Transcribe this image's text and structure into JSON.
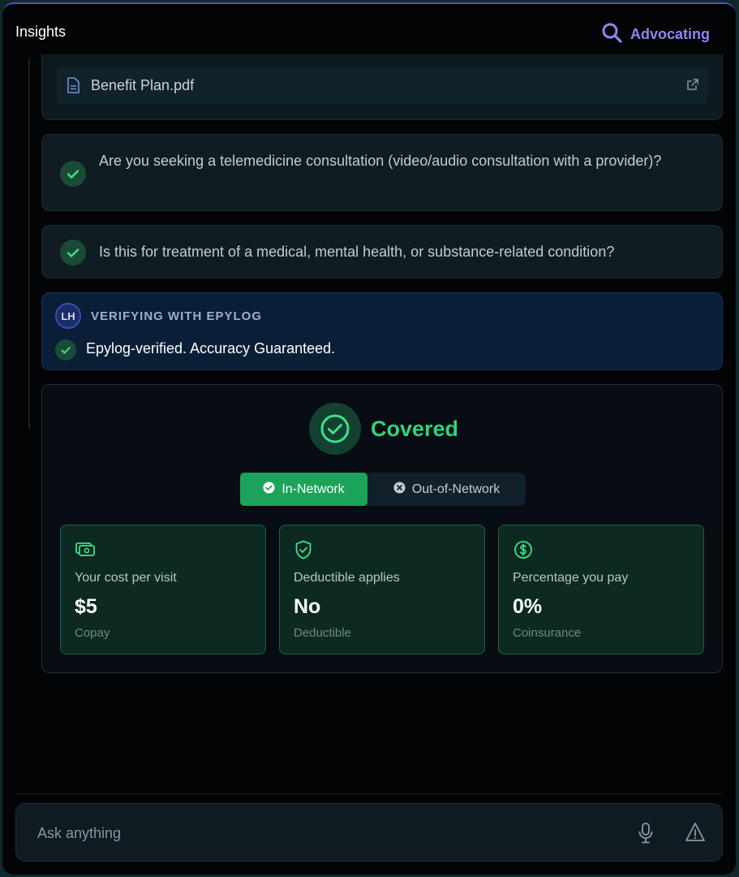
{
  "header": {
    "title": "Insights",
    "status_label": "Advocating"
  },
  "attachment": {
    "file_name": "Benefit Plan.pdf"
  },
  "questions": [
    {
      "text": "Are you seeking a telemedicine consultation (video/audio consultation with a provider)?"
    },
    {
      "text": "Is this for treatment of a medical, mental health, or substance-related condition?"
    }
  ],
  "verification": {
    "avatar_initials": "LH",
    "heading": "VERIFYING WITH EPYLOG",
    "message": "Epylog-verified. Accuracy Guaranteed."
  },
  "result": {
    "status": "Covered",
    "network_tabs": [
      {
        "label": "In-Network",
        "selected": true
      },
      {
        "label": "Out-of-Network",
        "selected": false
      }
    ],
    "stats": [
      {
        "icon": "cash-icon",
        "label": "Your cost per visit",
        "value": "$5",
        "sub": "Copay"
      },
      {
        "icon": "shield-check-icon",
        "label": "Deductible applies",
        "value": "No",
        "sub": "Deductible"
      },
      {
        "icon": "dollar-circle-icon",
        "label": "Percentage you pay",
        "value": "0%",
        "sub": "Coinsurance"
      }
    ]
  },
  "composer": {
    "placeholder": "Ask anything"
  },
  "colors": {
    "accent_green": "#34d17a",
    "accent_purple": "#8f86f2",
    "background": "#030405"
  }
}
